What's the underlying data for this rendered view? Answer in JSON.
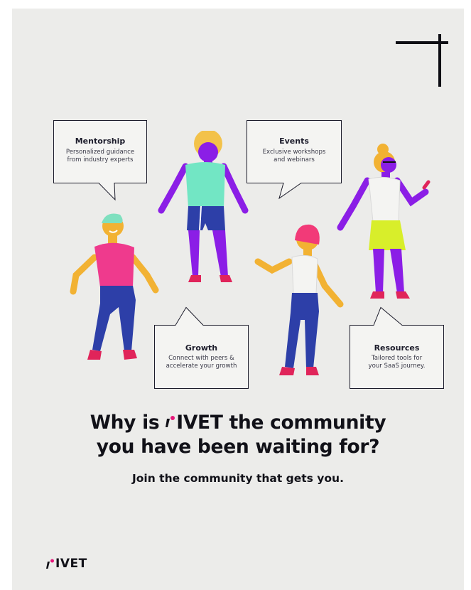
{
  "bubbles": {
    "mentorship": {
      "title": "Mentorship",
      "desc": "Personalized guidance\nfrom industry experts"
    },
    "events": {
      "title": "Events",
      "desc": "Exclusive workshops\nand webinars"
    },
    "growth": {
      "title": "Growth",
      "desc": "Connect with peers &\naccelerate your growth"
    },
    "resources": {
      "title": "Resources",
      "desc": "Tailored tools for\nyour SaaS journey."
    }
  },
  "headline": {
    "part1": "Why is ",
    "brand": "IVET",
    "part2": " the community",
    "line2": "you have been waiting for?"
  },
  "subline": "Join the community that gets you.",
  "footer": {
    "brand": "IVET"
  },
  "colors": {
    "background": "#ececea",
    "text": "#111118",
    "accent_pink": "#e6187a",
    "purple": "#8b1ee6",
    "blue": "#2d3fa8",
    "yellow": "#f2b233"
  },
  "icons": [
    "corner-mark-icon",
    "brand-mark-icon"
  ]
}
